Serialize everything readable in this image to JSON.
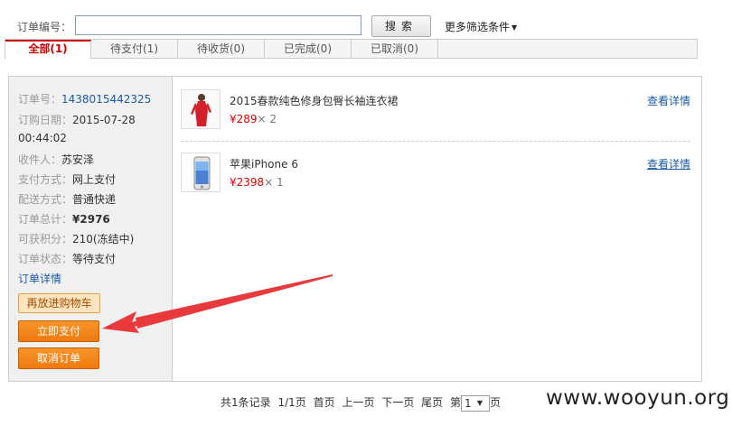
{
  "search": {
    "label": "订单编号：",
    "value": "",
    "placeholder": "",
    "button": "搜索",
    "more_filters": "更多筛选条件"
  },
  "tabs": [
    {
      "label": "全部(1)",
      "active": true
    },
    {
      "label": "待支付(1)",
      "active": false
    },
    {
      "label": "待收货(0)",
      "active": false
    },
    {
      "label": "已完成(0)",
      "active": false
    },
    {
      "label": "已取消(0)",
      "active": false
    }
  ],
  "order": {
    "number_label": "订单号：",
    "number": "1438015442325",
    "date_label": "订购日期：",
    "date": "2015-07-28",
    "time": "00:44:02",
    "receiver_label": "收件人：",
    "receiver": "苏安泽",
    "payment_label": "支付方式：",
    "payment": "网上支付",
    "delivery_label": "配送方式：",
    "delivery": "普通快递",
    "total_label": "订单总计：",
    "total": "¥2976",
    "points_label": "可获积分：",
    "points": "210(冻结中)",
    "status_label": "订单状态：",
    "status": "等待支付",
    "detail_link": "订单详情",
    "readd_button": "再放进购物车",
    "pay_button": "立即支付",
    "cancel_button": "取消订单"
  },
  "items": [
    {
      "name": "2015春款纯色修身包臀长袖连衣裙",
      "price": "¥289",
      "qty": "× 2",
      "link": "查看详情",
      "icon": "dress-thumbnail"
    },
    {
      "name": "苹果iPhone 6",
      "price": "¥2398",
      "qty": "× 1",
      "link": "查看详情",
      "icon": "phone-thumbnail"
    }
  ],
  "pager": {
    "records": "共1条记录",
    "pages": "1/1页",
    "first": "首页",
    "prev": "上一页",
    "next": "下一页",
    "last": "尾页",
    "goto_prefix": "第",
    "current": "1",
    "goto_suffix": "页"
  },
  "watermark": "www.wooyun.org",
  "colors": {
    "accent": "#cc0000",
    "link": "#1a5aa6",
    "button": "#ef7a0f",
    "arrow": "#e8393c"
  }
}
